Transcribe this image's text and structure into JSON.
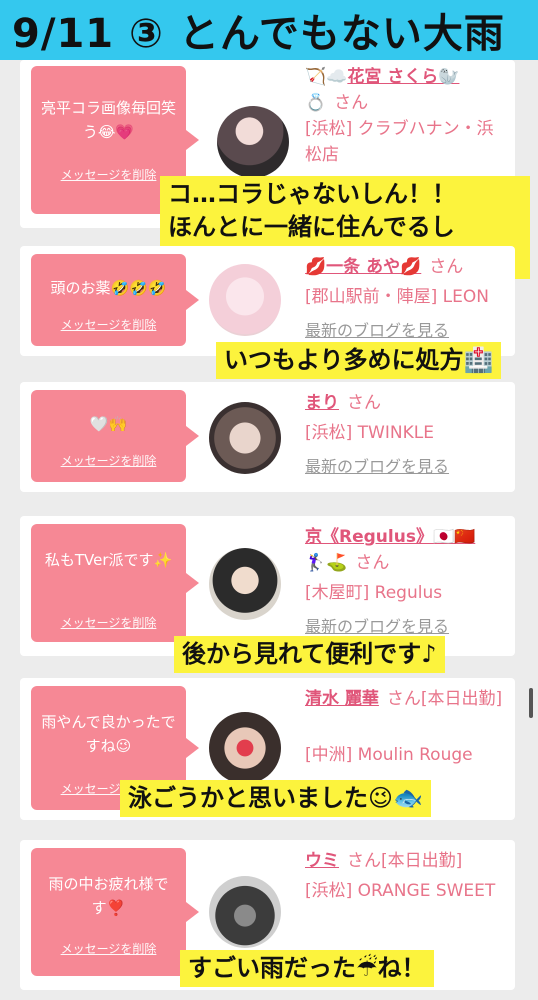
{
  "title": "9/11 ③ とんでもない大雨",
  "delete_label": "メッセージを削除",
  "san": "さん",
  "blog_link": "最新のブログを見る",
  "cards": [
    {
      "message": "亮平コラ画像毎回笑う😂💗",
      "name_prefix": "🏹☁️",
      "name": "花宮 さくら🦭",
      "name_suffix": "💍",
      "shop": "[浜松] クラブハナン・浜松店",
      "caption": "コ…コラじゃないしん！！\nほんとに一緒に住んでるしん！！"
    },
    {
      "message": "頭のお薬🤣🤣🤣",
      "name": "💋一条 あや💋",
      "shop": "[郡山駅前・陣屋] LEON",
      "caption": "いつもより多めに処方🏥"
    },
    {
      "message": "🤍🙌",
      "name": "まり",
      "shop": "[浜松] TWINKLE"
    },
    {
      "message": "私もTVer派です✨",
      "name": "京《Regulus》🇯🇵🇨🇳",
      "name_line2": "🏌️‍♀️⛳️",
      "shop": "[木屋町] Regulus",
      "caption": "後から見れて便利です♪"
    },
    {
      "message": "雨やんで良かったですね😉",
      "name": "清水 麗華",
      "status": "さん[本日出勤]",
      "shop": "[中洲] Moulin Rouge",
      "caption": "泳ごうかと思いました😉🐟"
    },
    {
      "message": "雨の中お疲れ様です❣️",
      "name": "ウミ",
      "status": "さん[本日出勤]",
      "shop": "[浜松] ORANGE SWEET",
      "caption": "すごい雨だった☔ね！"
    }
  ]
}
